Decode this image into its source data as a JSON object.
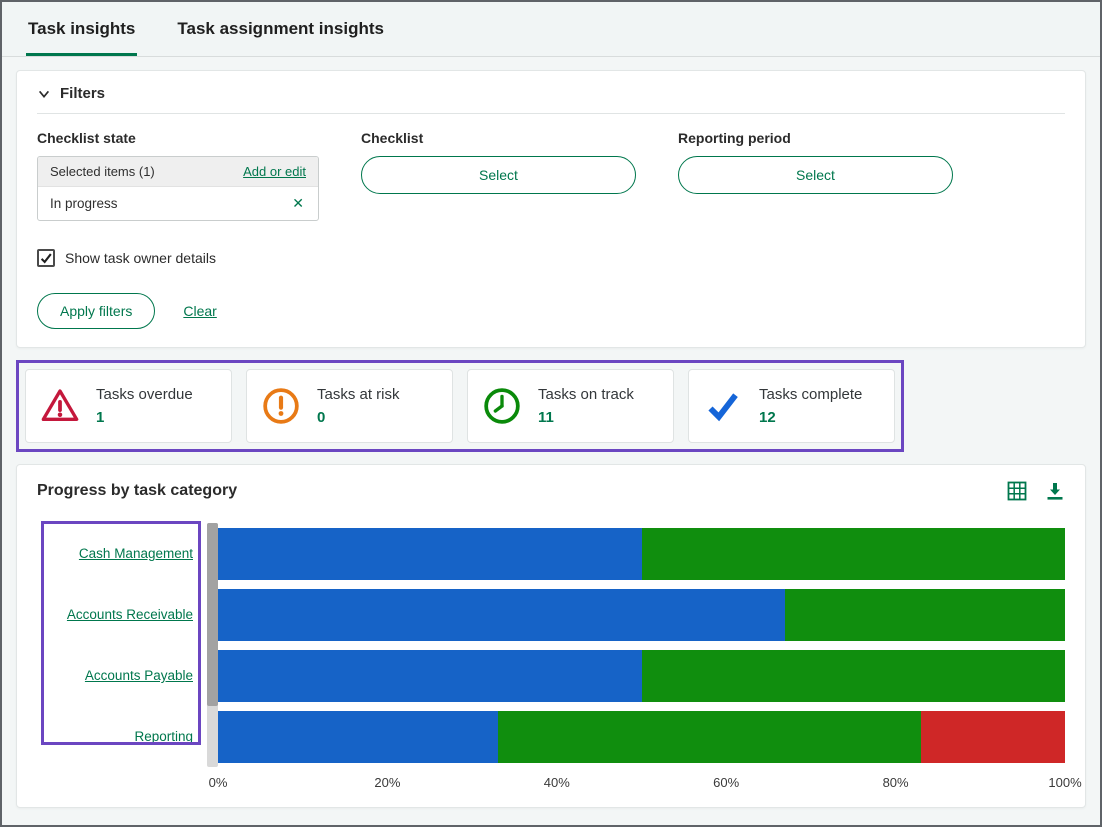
{
  "tabs": [
    {
      "label": "Task insights",
      "active": true
    },
    {
      "label": "Task assignment insights",
      "active": false
    }
  ],
  "filters": {
    "title": "Filters",
    "checklist_state": {
      "label": "Checklist state",
      "selected_items_text": "Selected items (1)",
      "add_or_edit_label": "Add or edit",
      "selected_value": "In progress"
    },
    "checklist": {
      "label": "Checklist",
      "button_label": "Select"
    },
    "reporting_period": {
      "label": "Reporting period",
      "button_label": "Select"
    },
    "show_task_owner_details_label": "Show task owner details",
    "show_task_owner_details_checked": true,
    "apply_button_label": "Apply filters",
    "clear_link_label": "Clear"
  },
  "stat_cards": [
    {
      "label": "Tasks overdue",
      "value": "1",
      "icon": "warning-triangle-icon",
      "icon_color": "#c4183c"
    },
    {
      "label": "Tasks at risk",
      "value": "0",
      "icon": "exclamation-circle-icon",
      "icon_color": "#e87a16"
    },
    {
      "label": "Tasks on track",
      "value": "11",
      "icon": "clock-icon",
      "icon_color": "#0a8a0a"
    },
    {
      "label": "Tasks complete",
      "value": "12",
      "icon": "check-icon",
      "icon_color": "#1565d8"
    }
  ],
  "progress_panel": {
    "title": "Progress by task category",
    "icons": [
      "table-icon",
      "download-icon"
    ]
  },
  "chart_data": {
    "type": "bar",
    "orientation": "horizontal",
    "stacked": true,
    "title": "Progress by task category",
    "categories": [
      "Cash Management",
      "Accounts Receivable",
      "Accounts Payable",
      "Reporting"
    ],
    "series": [
      {
        "color": "#1663c7",
        "values": [
          50,
          67,
          50,
          33
        ]
      },
      {
        "color": "#108e0e",
        "values": [
          50,
          33,
          50,
          50
        ]
      },
      {
        "color": "#cf2727",
        "values": [
          0,
          0,
          0,
          17
        ]
      }
    ],
    "xlim": [
      0,
      100
    ],
    "x_tick_labels": [
      "0%",
      "20%",
      "40%",
      "60%",
      "80%",
      "100%"
    ],
    "grid": false,
    "legend": "none",
    "accent_colors": {
      "brand_green": "#00774d",
      "highlight_purple": "#6b46c1"
    }
  }
}
